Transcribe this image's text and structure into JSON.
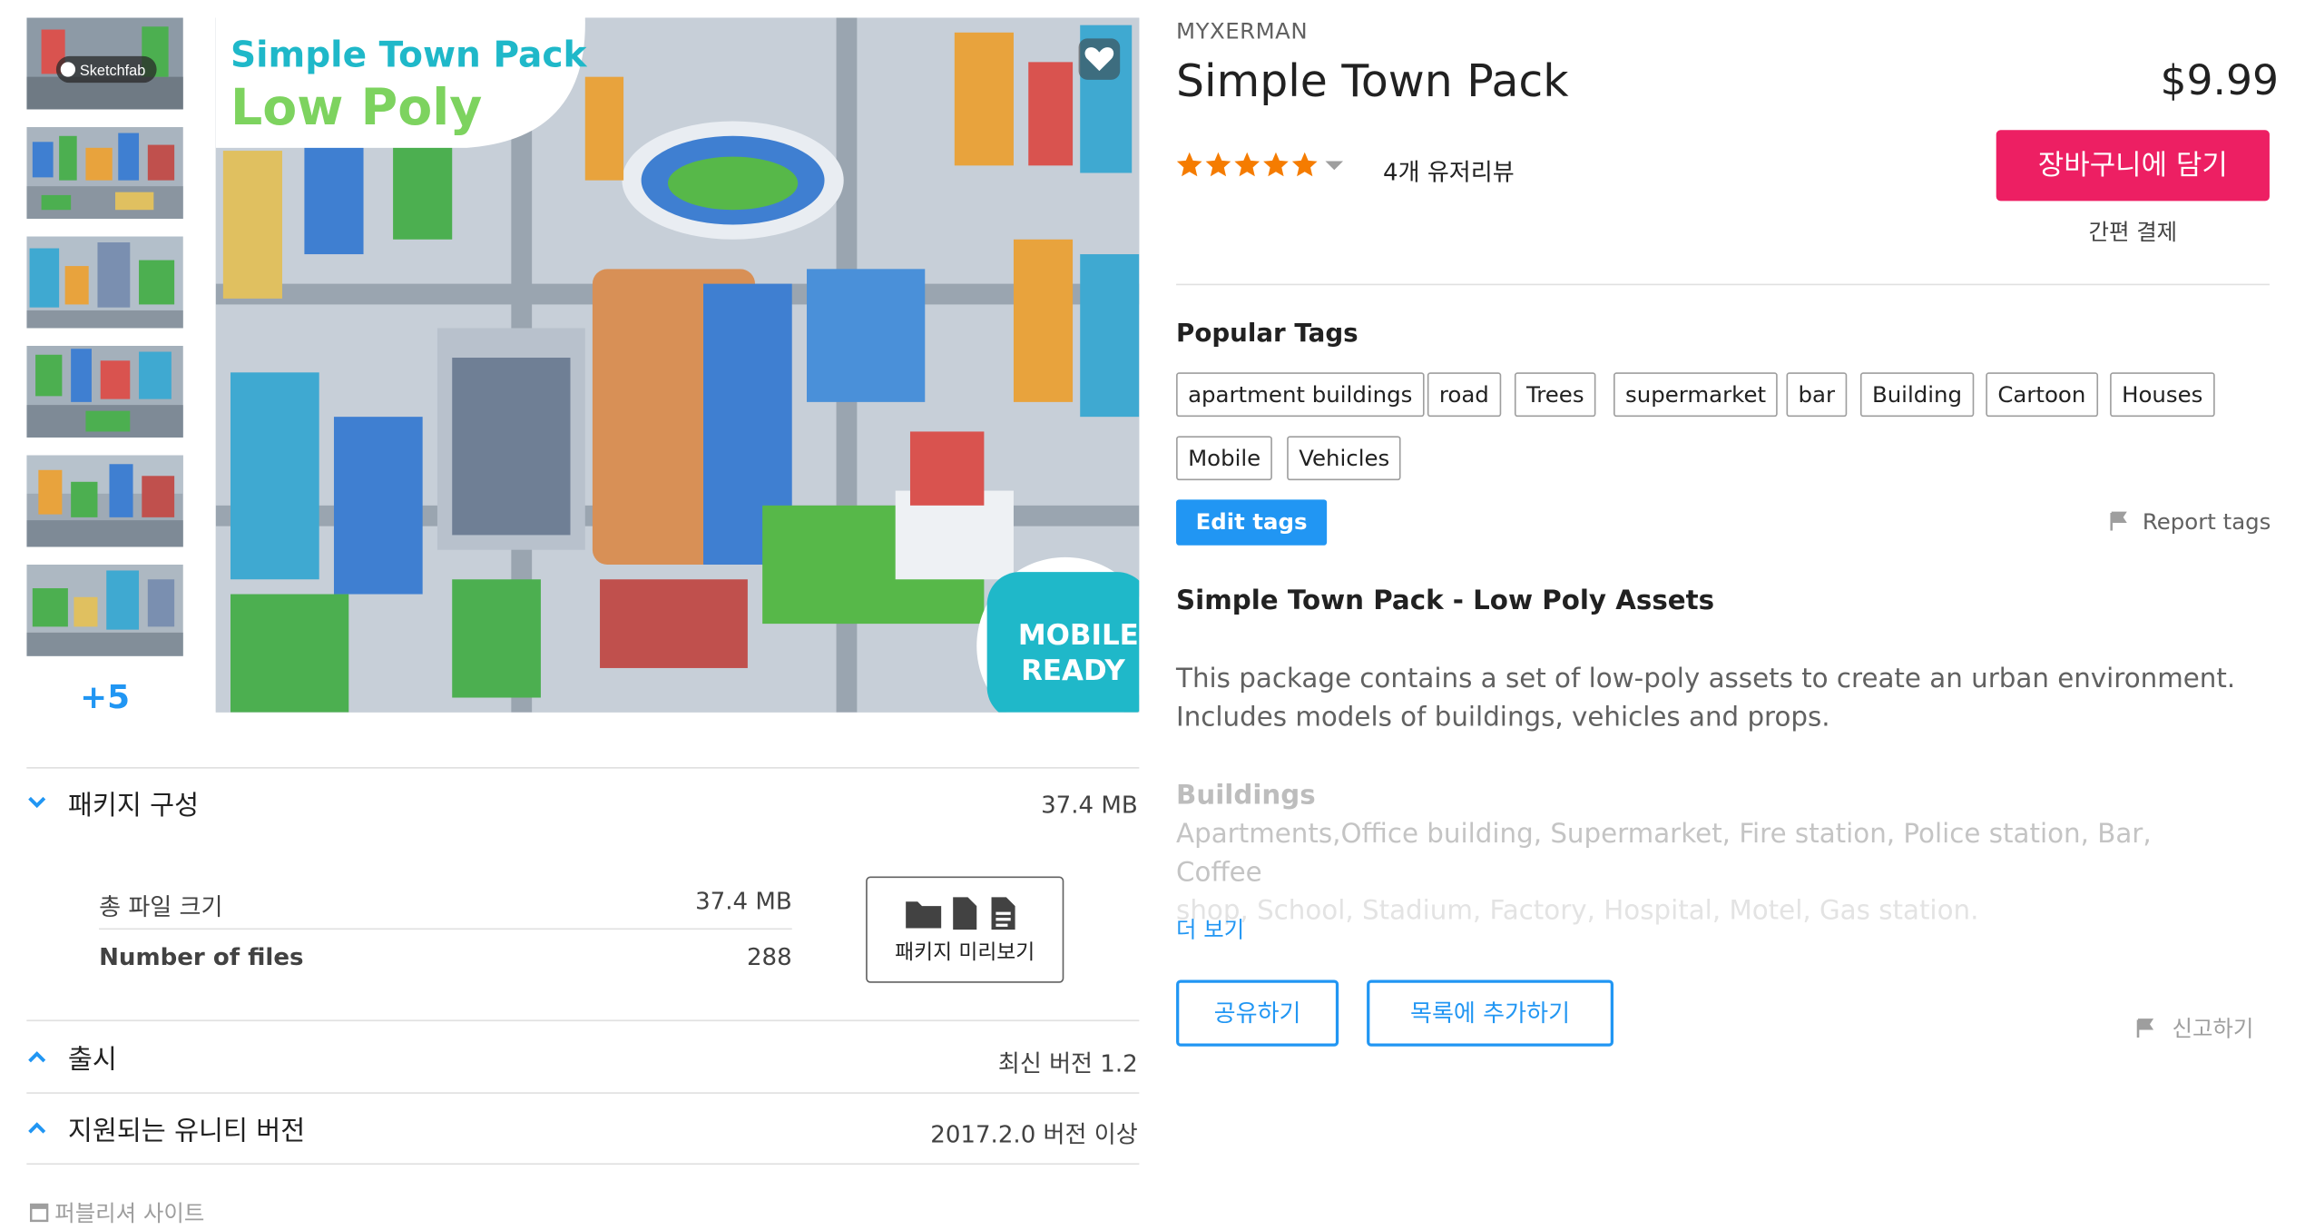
{
  "thumbnails": {
    "first_badge": "Sketchfab",
    "more_count": "+5"
  },
  "preview": {
    "banner_line1": "Simple Town Pack",
    "banner_line2": "Low Poly",
    "badge_line1": "MOBILE",
    "badge_line2": "READY"
  },
  "package": {
    "section_label": "패키지 구성",
    "section_size": "37.4 MB",
    "total_size_label": "총 파일 크기",
    "total_size_value": "37.4 MB",
    "files_label": "Number of files",
    "files_value": "288",
    "preview_button": "패키지 미리보기"
  },
  "release": {
    "label": "출시",
    "value": "최신 버전 1.2"
  },
  "unity": {
    "label": "지원되는 유니티 버전",
    "value": "2017.2.0 버전 이상"
  },
  "publisher_site": "퍼블리셔 사이트",
  "product": {
    "publisher": "MYXERMAN",
    "title": "Simple Town Pack",
    "price": "$9.99",
    "add_to_cart": "장바구니에 담기",
    "quick_checkout": "간편 결제",
    "rating": 5,
    "reviews": "4개 유저리뷰"
  },
  "tags": {
    "heading": "Popular Tags",
    "items": [
      "apartment buildings",
      "road",
      "Trees",
      "supermarket",
      "bar",
      "Building",
      "Cartoon",
      "Houses",
      "Mobile",
      "Vehicles"
    ],
    "edit": "Edit tags",
    "report": "Report tags"
  },
  "description": {
    "heading": "Simple Town Pack - Low Poly Assets",
    "para1": "This package contains a set of low-poly assets to create an urban environment.",
    "para2": "Includes models of buildings, vehicles and props.",
    "buildings_heading": "Buildings",
    "buildings_line1": "Apartments,Office building, Supermarket, Fire station, Police station, Bar, Coffee",
    "buildings_line2": "shop, School, Stadium, Factory, Hospital, Motel, Gas station.",
    "more_link": "더 보기"
  },
  "actions": {
    "share": "공유하기",
    "add_to_list": "목록에 추가하기",
    "report": "신고하기"
  },
  "colors": {
    "accent_blue": "#2196f3",
    "cart_pink": "#ed1f63",
    "star": "#f57c00"
  }
}
